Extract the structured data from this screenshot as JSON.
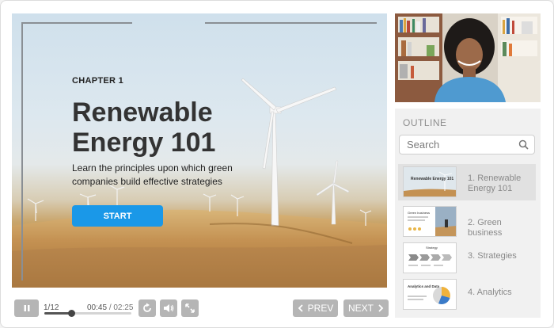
{
  "slide": {
    "chapter": "CHAPTER 1",
    "title": "Renewable Energy 101",
    "subtitle": "Learn the principles upon which green companies build effective strategies",
    "start_label": "START"
  },
  "player": {
    "slide_count": "1/12",
    "time_current": "00:45",
    "time_total": "/ 02:25",
    "progress_fraction": 0.31,
    "prev_label": "PREV",
    "next_label": "NEXT",
    "icons": {
      "pause": "pause-icon",
      "replay": "replay-icon",
      "volume": "volume-icon",
      "fullscreen": "fullscreen-icon",
      "prev": "chevron-left-icon",
      "next": "chevron-right-icon"
    }
  },
  "sidebar": {
    "outline_title": "OUTLINE",
    "search_placeholder": "Search",
    "items": [
      {
        "label": "1. Renewable Energy 101",
        "thumb_title": "Renewable Energy 101",
        "active": true
      },
      {
        "label": "2. Green business",
        "thumb_title": "Green business",
        "active": false
      },
      {
        "label": "3. Strategies",
        "thumb_title": "Strategy",
        "active": false
      },
      {
        "label": "4. Analytics",
        "thumb_title": "Analytics and Data",
        "active": false
      }
    ]
  },
  "colors": {
    "accent": "#1a98e8",
    "control_gray": "#b5b5b5",
    "outline_active": "#e1e1e1"
  }
}
